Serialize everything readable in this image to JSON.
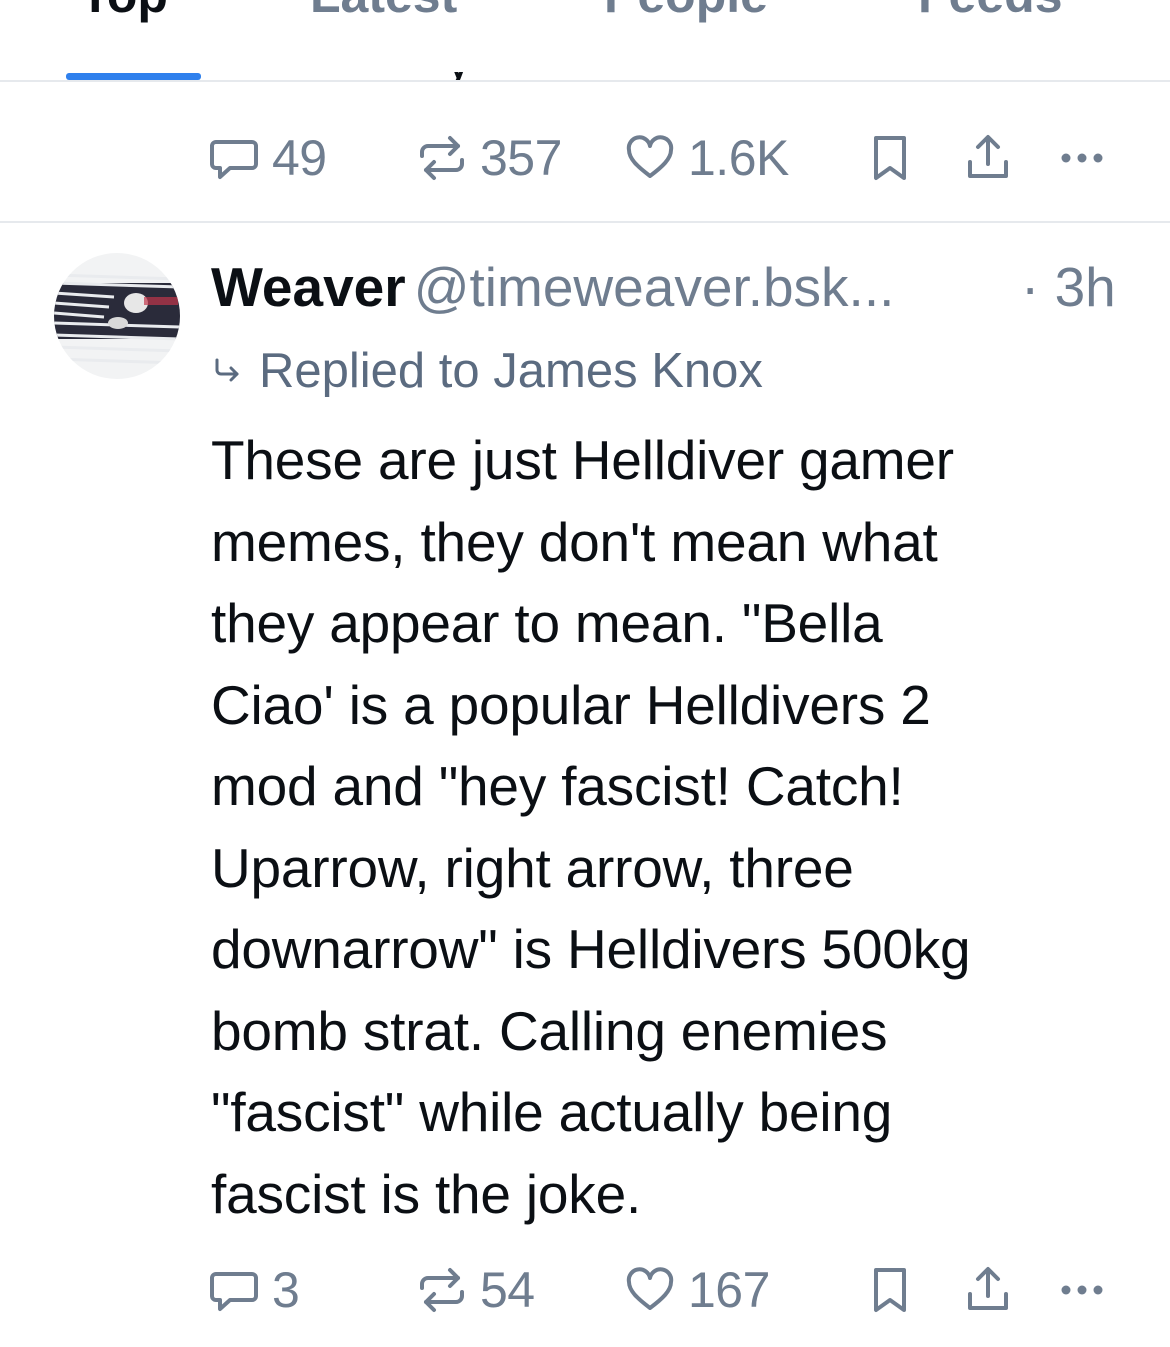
{
  "tabs": [
    {
      "label": "Top",
      "active": true
    },
    {
      "label": "Latest",
      "active": false
    },
    {
      "label": "People",
      "active": false
    },
    {
      "label": "Feeds",
      "active": false
    }
  ],
  "previous_post": {
    "clipped_text": "y",
    "actions": {
      "replies": "49",
      "reposts": "357",
      "likes": "1.6K"
    }
  },
  "post": {
    "display_name": "Weaver",
    "handle": "@timeweaver.bsk...",
    "time": "· 3h",
    "reply_context": "Replied to James Knox",
    "text_lines": [
      "These are just Helldiver gamer",
      "memes, they don't mean what",
      "they appear to mean. \"Bella",
      "Ciao' is a popular Helldivers 2",
      "mod and \"hey fascist! Catch!",
      "Uparrow, right arrow, three",
      "downarrow\" is Helldivers 500kg",
      "bomb strat. Calling enemies",
      "\"fascist\" while actually being",
      "fascist is the joke."
    ],
    "actions": {
      "replies": "3",
      "reposts": "54",
      "likes": "167"
    }
  },
  "icons": {
    "reply": "speech-bubble-icon",
    "repost": "repost-arrows-icon",
    "like": "heart-icon",
    "bookmark": "bookmark-icon",
    "share": "share-upload-icon",
    "more": "ellipsis-icon",
    "reply_context": "reply-arrow-icon"
  },
  "colors": {
    "accent": "#2f80ed",
    "muted_text": "#6f7d8f",
    "reply_context_text": "#5b6b80",
    "primary_text": "#0b0f14",
    "divider": "#e6e9ed"
  }
}
